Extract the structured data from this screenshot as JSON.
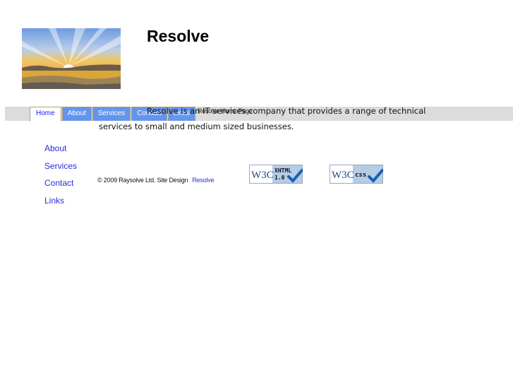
{
  "header": {
    "site_title": "Resolve",
    "logo_alt": "Sunrise watercolor logo"
  },
  "nav": {
    "tabs": [
      {
        "label": "Home",
        "active": true
      },
      {
        "label": "About",
        "active": false
      },
      {
        "label": "Services",
        "active": false
      },
      {
        "label": "Contact",
        "active": false
      },
      {
        "label": "Links",
        "active": false
      }
    ],
    "page_label": "Resolve Home Page"
  },
  "intro": {
    "line1": "Resolve is an IT services company that provides a range of technical",
    "line2": "services to small and medium sized businesses."
  },
  "sidebar": {
    "items": [
      {
        "label": "About"
      },
      {
        "label": "Services"
      },
      {
        "label": "Contact"
      },
      {
        "label": "Links"
      }
    ]
  },
  "footer": {
    "copyright": "© 2009 Raysolve Ltd. Site Design",
    "designer_link": "Resolve"
  },
  "badges": {
    "xhtml": {
      "brand": "W3C",
      "line1": "XHTML",
      "line2": "1.0"
    },
    "css": {
      "brand": "W3C",
      "line1": "css"
    }
  },
  "colors": {
    "tab_bg": "#6495ed",
    "tab_border": "#b09f78",
    "navbar_bg": "#dcdcdc",
    "link": "#2c2cd6"
  }
}
